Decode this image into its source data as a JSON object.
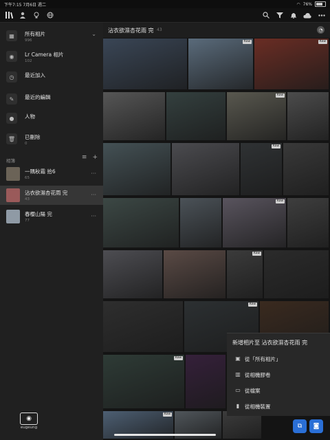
{
  "status": {
    "time": "下午7:15",
    "date": "7月6日 週二",
    "battery": "76%",
    "battery_level": 76
  },
  "toolbar": {
    "left_icons": [
      "library-icon",
      "people-icon",
      "lightbulb-icon",
      "globe-icon"
    ],
    "right_icons": [
      "search-icon",
      "filter-icon",
      "bell-icon",
      "cloud-icon",
      "more-icon"
    ]
  },
  "sidebar": {
    "albums": [
      {
        "title": "所有相片",
        "count": "996",
        "icon": "photo-library-icon"
      },
      {
        "title": "Lr Camera 相片",
        "count": "102",
        "icon": "camera-icon"
      },
      {
        "title": "最近加入",
        "count": "",
        "icon": "clock-icon"
      },
      {
        "title": "最近的編輯",
        "count": "",
        "icon": "edit-icon"
      },
      {
        "title": "人物",
        "count": "",
        "icon": "person-icon"
      },
      {
        "title": "已刪除",
        "count": "0",
        "icon": "trash-icon"
      }
    ],
    "section_label": "相簿",
    "collections": [
      {
        "title": "一隅秋霜 拾6",
        "count": "65",
        "selected": false,
        "color": "#6b6357"
      },
      {
        "title": "沾衣欲濕杏花雨 完",
        "count": "43",
        "selected": true,
        "color": "#9a5a5a"
      },
      {
        "title": "春櫻山陽 完",
        "count": "77",
        "selected": false,
        "color": "#8f9aa5"
      }
    ],
    "logo_text": "eugeung"
  },
  "main": {
    "title": "沾衣欲濕杏花雨 完",
    "count": "43",
    "raw_label": "Raw",
    "photos": [
      {
        "color": "#3a4656",
        "raw": false
      },
      {
        "color": "#5a6b7b",
        "raw": true
      },
      {
        "color": "#6a2d24",
        "raw": true
      },
      {
        "color": "#565656",
        "raw": false
      },
      {
        "color": "#34403f",
        "raw": false
      },
      {
        "color": "#59584f",
        "raw": true
      },
      {
        "color": "#4c4c4c",
        "raw": false
      },
      {
        "color": "#445155",
        "raw": false
      },
      {
        "color": "#4b4b4f",
        "raw": false
      },
      {
        "color": "#2f3234",
        "raw": true
      },
      {
        "color": "#393939",
        "raw": false
      },
      {
        "color": "#3c4845",
        "raw": false
      },
      {
        "color": "#4b5258",
        "raw": false
      },
      {
        "color": "#59545e",
        "raw": true
      },
      {
        "color": "#3e3e3e",
        "raw": false
      },
      {
        "color": "#4d4d52",
        "raw": false
      },
      {
        "color": "#5a4a45",
        "raw": false
      },
      {
        "color": "#3b3b3b",
        "raw": true
      },
      {
        "color": "#2b2b2b",
        "raw": false
      },
      {
        "color": "#2e2e2e",
        "raw": false
      },
      {
        "color": "#2c3032",
        "raw": true
      },
      {
        "color": "#3a2a1f",
        "raw": false
      },
      {
        "color": "#2e3b36",
        "raw": true
      },
      {
        "color": "#35203a",
        "raw": false
      },
      {
        "color": "#4d5f73",
        "raw": true
      },
      {
        "color": "#50565b",
        "raw": false
      },
      {
        "color": "#3c3c3c",
        "raw": false
      }
    ]
  },
  "popup": {
    "header": "新增相片至 沾衣欲濕杏花雨 完",
    "items": [
      {
        "label": "從「所有相片」",
        "icon": "photos-icon"
      },
      {
        "label": "從相機膠卷",
        "icon": "camera-roll-icon"
      },
      {
        "label": "從檔案",
        "icon": "folder-icon"
      },
      {
        "label": "從相機裝置",
        "icon": "sd-card-icon"
      }
    ]
  },
  "fab": {
    "add_icon": "add-photo-icon",
    "camera_icon": "camera-icon"
  }
}
